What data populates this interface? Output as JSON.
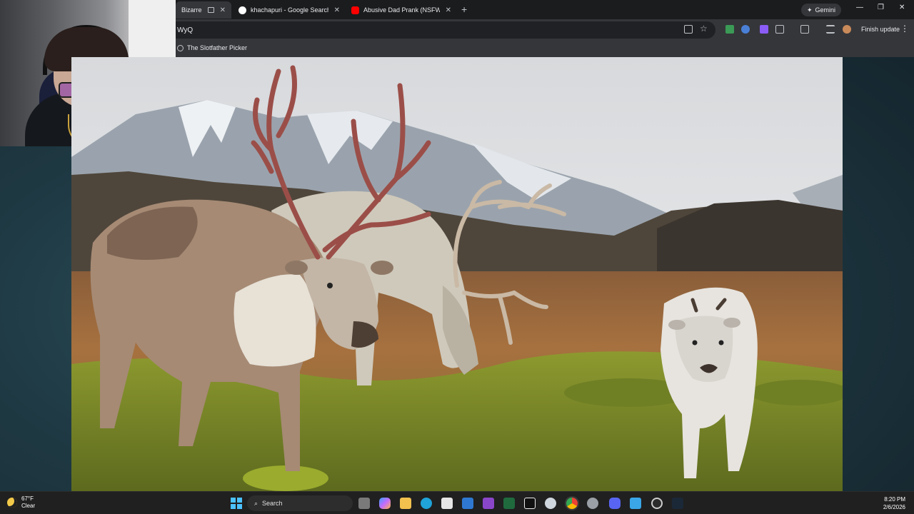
{
  "browser": {
    "tabs": [
      {
        "label": "Bizarre Isla",
        "active": true,
        "favicon_color": "#9aa0a6"
      },
      {
        "label": "khachapuri - Google Search",
        "active": false,
        "favicon_color": "#ffffff"
      },
      {
        "label": "Abusive Dad Prank (NSFW) - Yo",
        "active": false,
        "favicon_color": "#ff0000"
      }
    ],
    "gemini_label": "Gemini",
    "omnibox_text": "WyQ",
    "finish_update_label": "Finish update",
    "bookmark_label": "The Slotfather Picker"
  },
  "taskbar": {
    "weather_temp": "67°F",
    "weather_condition": "Clear",
    "search_label": "Search",
    "time": "8:20 PM",
    "date": "2/6/2026",
    "icons": [
      "widgets-icon",
      "file-explorer-icon",
      "copilot-icon",
      "folder-icon",
      "edge-icon",
      "store-icon",
      "outlook-icon",
      "tor-icon",
      "excel-icon",
      "capcut-icon",
      "ccleaner-icon",
      "chrome-icon",
      "settings-icon",
      "discord-icon",
      "paint-icon",
      "obs-icon",
      "steam-icon"
    ]
  },
  "photo": {
    "subject": "reindeer-grazing-scene"
  }
}
